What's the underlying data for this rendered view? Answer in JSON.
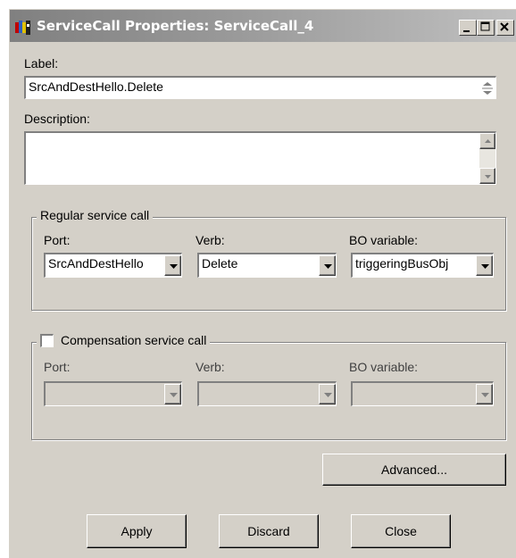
{
  "window": {
    "title": "ServiceCall Properties: ServiceCall_4"
  },
  "label_section": {
    "label": "Label:",
    "value": "SrcAndDestHello.Delete"
  },
  "description_section": {
    "label": "Description:",
    "value": ""
  },
  "regular": {
    "legend": "Regular service call",
    "port_label": "Port:",
    "port_value": "SrcAndDestHello",
    "verb_label": "Verb:",
    "verb_value": "Delete",
    "bo_label": "BO variable:",
    "bo_value": "triggeringBusObj"
  },
  "compensation": {
    "legend": "Compensation service call",
    "checked": false,
    "port_label": "Port:",
    "port_value": "",
    "verb_label": "Verb:",
    "verb_value": "",
    "bo_label": "BO variable:",
    "bo_value": ""
  },
  "buttons": {
    "advanced": "Advanced...",
    "apply": "Apply",
    "discard": "Discard",
    "close": "Close"
  },
  "colors": {
    "face": "#d4d0c8",
    "title_gradient_start": "#808080",
    "title_gradient_end": "#c0c0c0"
  }
}
